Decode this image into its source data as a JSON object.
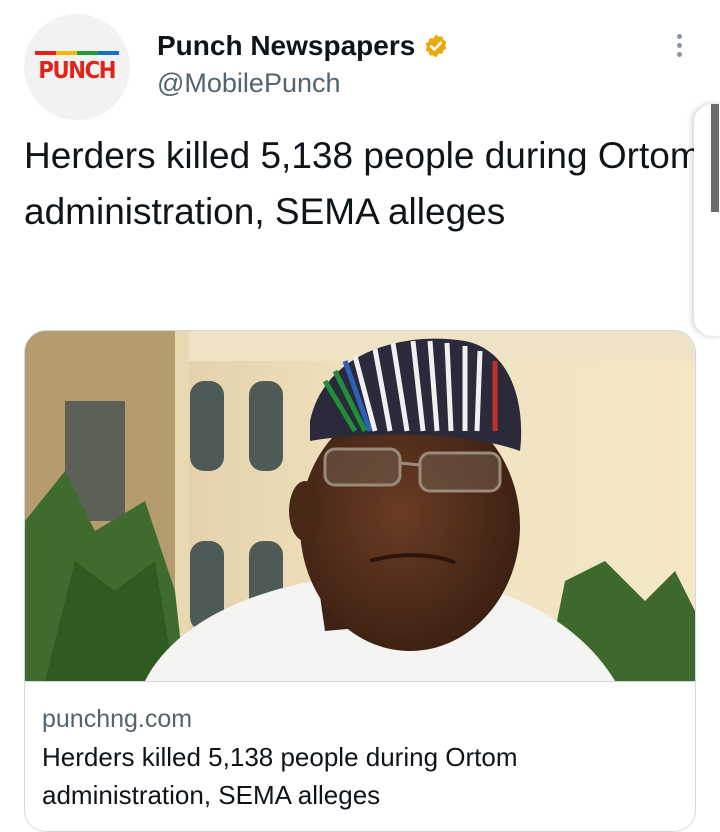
{
  "author": {
    "avatar_text": "PUNCH",
    "avatar_stripe_colors": [
      "#e2231a",
      "#f6b800",
      "#1f9e3a",
      "#1570c8"
    ],
    "display_name": "Punch Newspapers",
    "verified_color": "#e8a90b",
    "handle": "@MobilePunch"
  },
  "tweet": {
    "text": "Herders killed 5,138 people during Ortom administration, SEMA alleges"
  },
  "link_card": {
    "domain": "punchng.com",
    "title": "Herders killed 5,138 people during Ortom administration, SEMA alleges"
  },
  "icons": {
    "more": "more-vertical-icon",
    "verified": "verified-badge-icon"
  }
}
